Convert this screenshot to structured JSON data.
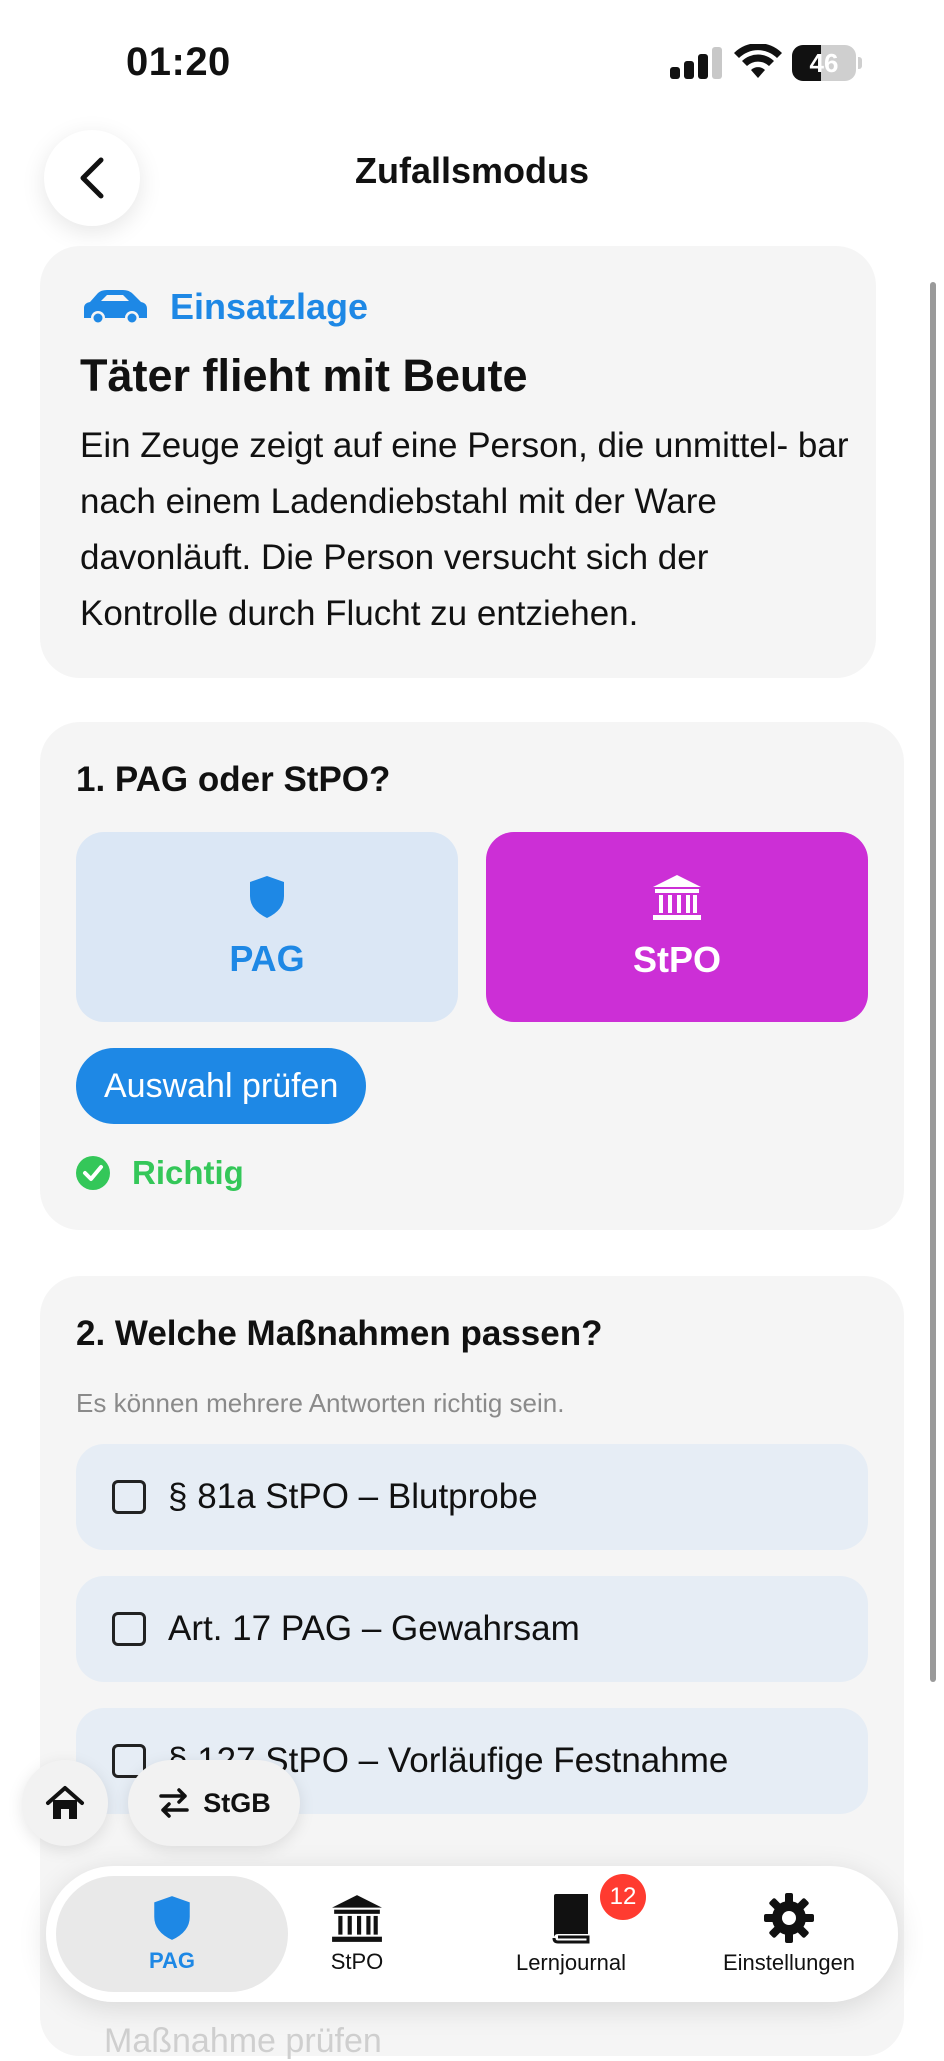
{
  "status_bar": {
    "time": "01:20",
    "battery_percent": "46",
    "battery_level": 0.46,
    "signal_bars": 3
  },
  "header": {
    "title": "Zufallsmodus",
    "back_icon": "chevron-left-icon"
  },
  "scenario": {
    "tag_icon": "car-icon",
    "tag": "Einsatzlage",
    "title": "Täter flieht mit Beute",
    "description": "Ein Zeuge zeigt auf eine Person, die unmittel- bar nach einem Ladendiebstahl mit der Ware davonläuft. Die Person versucht sich der Kontrolle durch Flucht zu entziehen."
  },
  "question1": {
    "title": "1. PAG oder StPO?",
    "options": [
      {
        "label": "PAG",
        "icon": "shield-icon",
        "selected": false
      },
      {
        "label": "StPO",
        "icon": "courthouse-icon",
        "selected": true
      }
    ],
    "check_button": "Auswahl prüfen",
    "result": "Richtig",
    "result_icon": "checkmark-circle-icon"
  },
  "question2": {
    "title": "2. Welche Maßnahmen passen?",
    "hint": "Es können mehrere Antworten richtig sein.",
    "answers": [
      {
        "label": "§ 81a StPO – Blutprobe",
        "checked": false
      },
      {
        "label": "Art. 17 PAG – Gewahrsam",
        "checked": false
      },
      {
        "label": "§ 127 StPO – Vorläufige Festnahme",
        "checked": false
      }
    ],
    "footer_ghost": "Maßnahme prüfen"
  },
  "floating": {
    "home_icon": "house-icon",
    "switch_icon": "arrows-swap-icon",
    "switch_label": "StGB"
  },
  "tabbar": {
    "tabs": [
      {
        "label": "PAG",
        "icon": "shield-icon",
        "active": true
      },
      {
        "label": "StPO",
        "icon": "courthouse-icon",
        "active": false
      },
      {
        "label": "Lernjournal",
        "icon": "book-icon",
        "active": false,
        "badge": "12"
      },
      {
        "label": "Einstellungen",
        "icon": "gear-icon",
        "active": false
      }
    ]
  },
  "colors": {
    "accent": "#1e88e5",
    "selected_option": "#cc2fd6",
    "success": "#34c759",
    "badge": "#ff3b30"
  }
}
